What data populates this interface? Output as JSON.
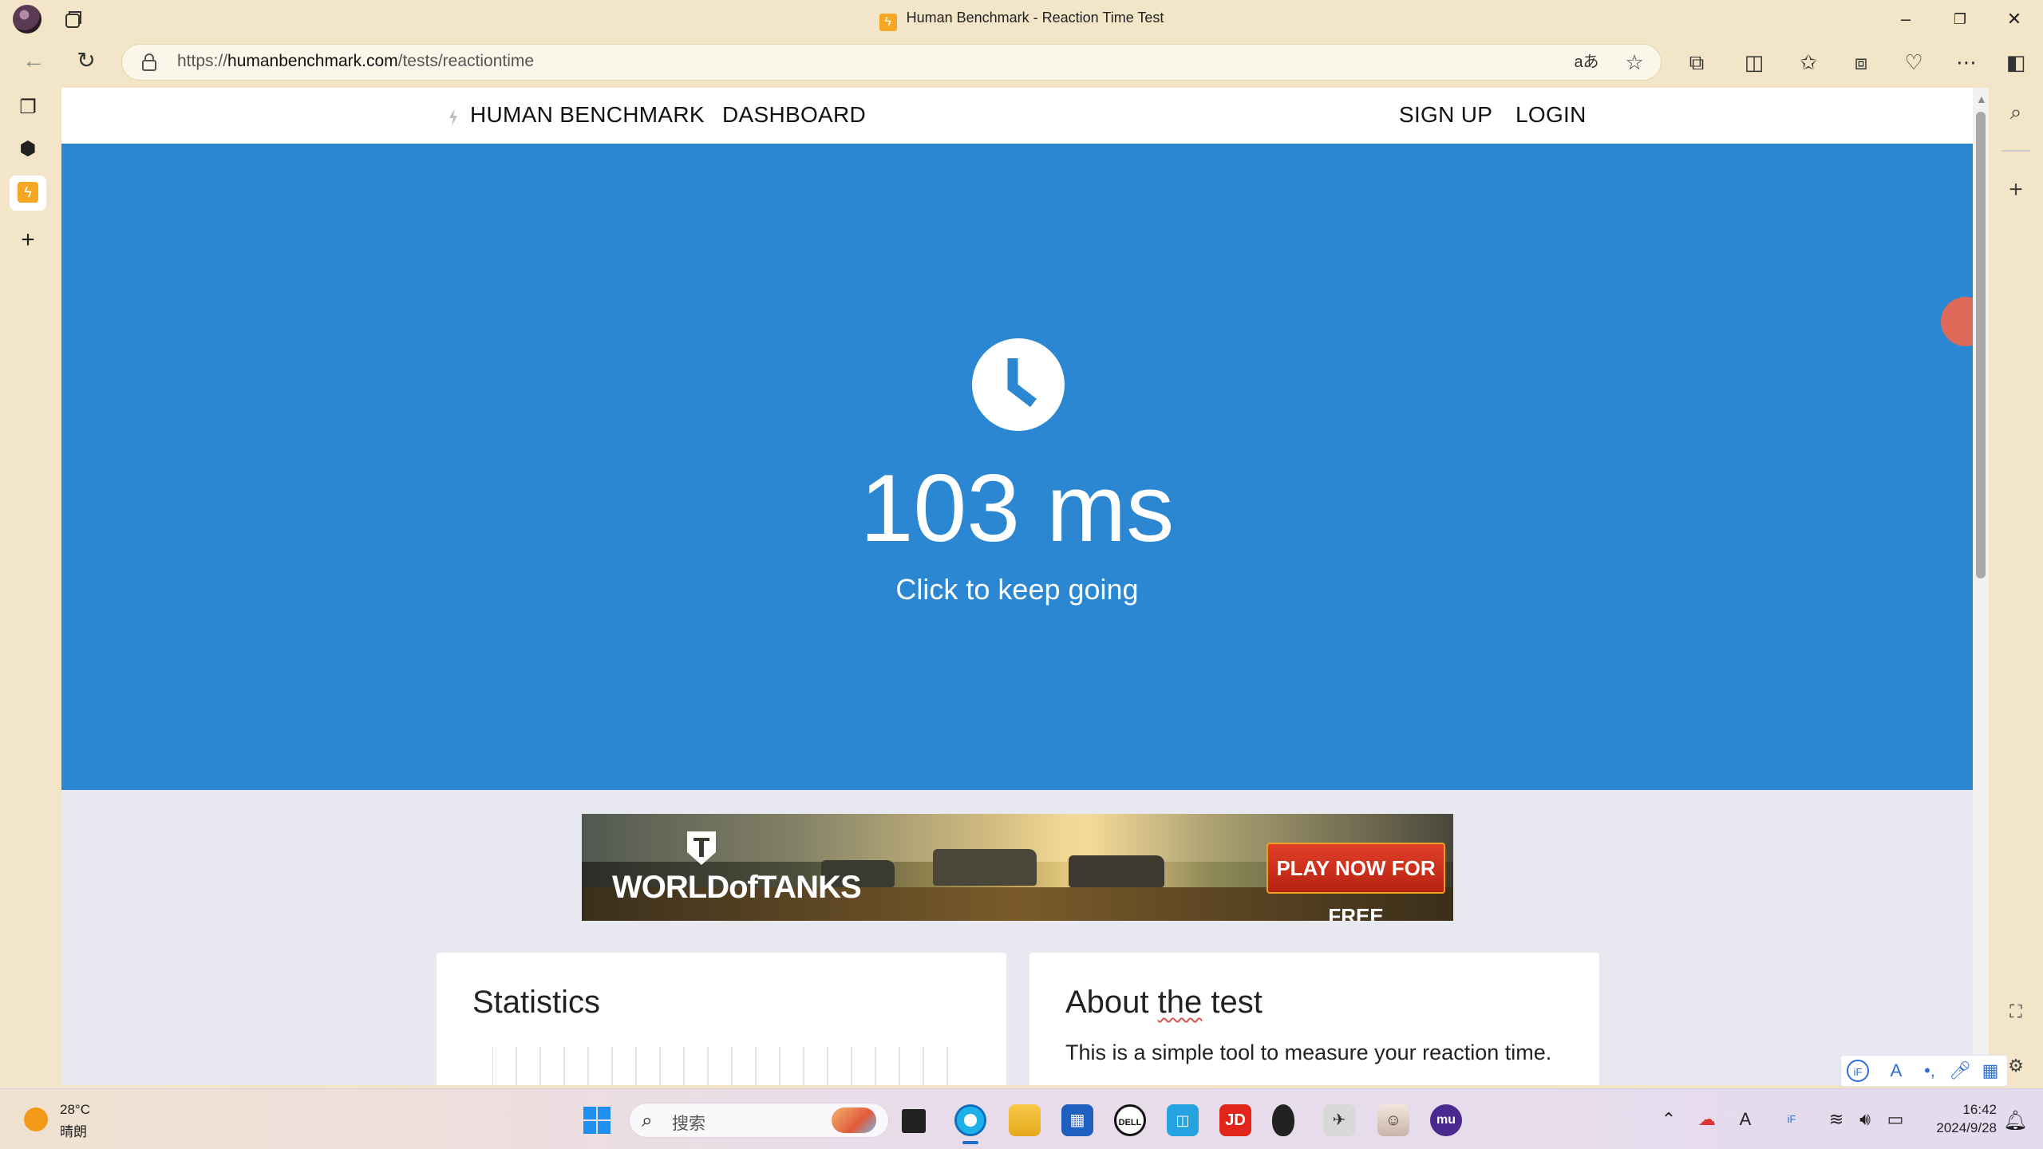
{
  "browser": {
    "window_title": "Human Benchmark - Reaction Time Test",
    "url_prefix": "https://",
    "url_domain": "humanbenchmark.com",
    "url_path": "/tests/reactiontime"
  },
  "site_nav": {
    "brand": "HUMAN BENCHMARK",
    "dashboard": "DASHBOARD",
    "sign_up": "SIGN UP",
    "login": "LOGIN"
  },
  "hero": {
    "result": "103 ms",
    "hint": "Click to keep going"
  },
  "ad": {
    "logo": "WORLDofTANKS",
    "cta": "PLAY NOW FOR FREE"
  },
  "cards": {
    "statistics_title": "Statistics",
    "about_title_pre": "About ",
    "about_title_word": "the",
    "about_title_post": " test",
    "about_text": "This is a simple tool to measure your reaction time."
  },
  "taskbar": {
    "weather_temp": "28°C",
    "weather_desc": "晴朗",
    "search_placeholder": "搜索",
    "time": "16:42",
    "date": "2024/9/28"
  },
  "colors": {
    "hero_blue": "#2b87d1",
    "browser_chrome": "#f3e6c8"
  }
}
